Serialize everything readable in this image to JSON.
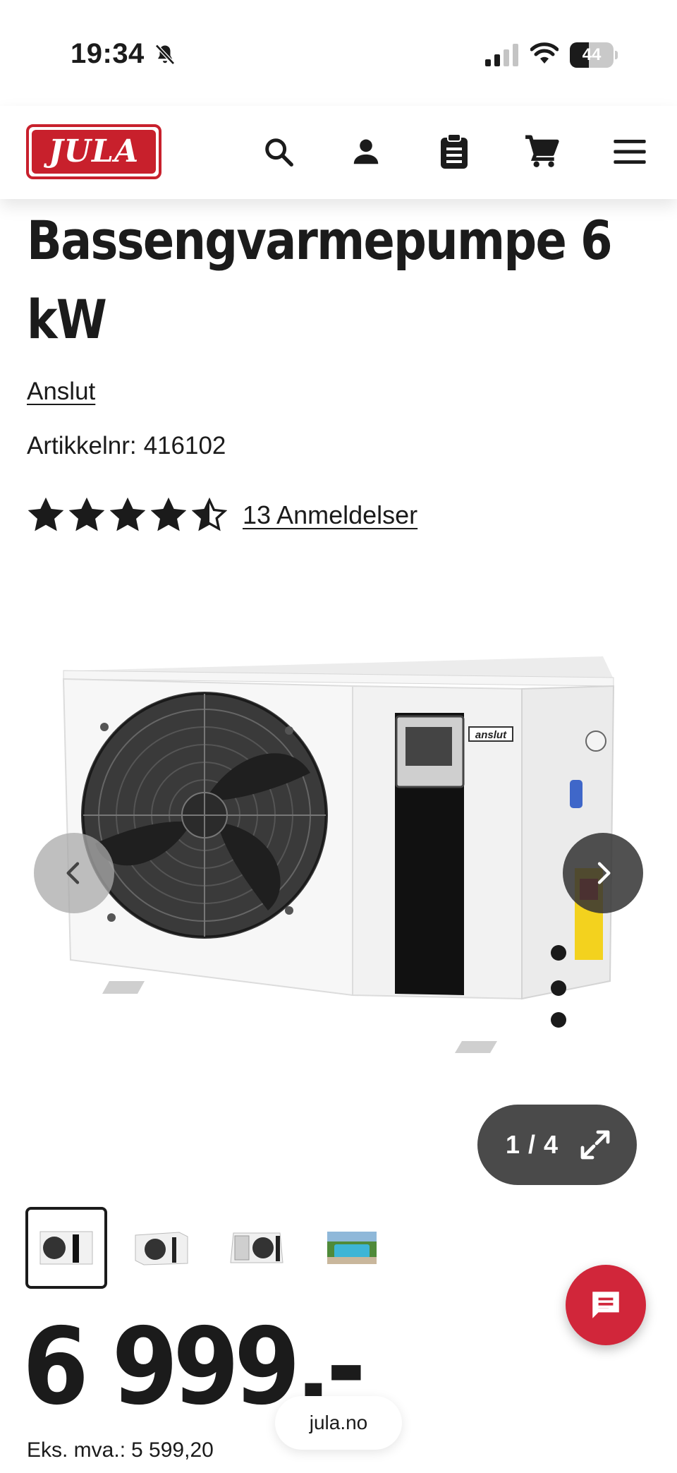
{
  "status_bar": {
    "time": "19:34",
    "battery_level": "44",
    "battery_fraction": 0.44,
    "icons": [
      "bell-slash-icon",
      "signal-icon",
      "wifi-icon",
      "battery-icon"
    ]
  },
  "header": {
    "logo_text": "JULA",
    "icons": [
      "search-icon",
      "account-icon",
      "clipboard-icon",
      "cart-icon",
      "menu-icon"
    ],
    "brand_color": "#c8202c"
  },
  "product": {
    "title": "Bassengvarmepumpe 6 kW",
    "brand": "Anslut",
    "article_label": "Artikkelnr:",
    "article_number": "416102",
    "rating": 4.5,
    "rating_max": 5,
    "reviews_label": "13 Anmeldelser",
    "image_counter": "1 / 4",
    "image_label": "anslut",
    "thumbnails": [
      "heat-pump-front",
      "heat-pump-angle",
      "heat-pump-back",
      "pool-photo"
    ],
    "active_thumbnail": 0,
    "price": "6 999,-",
    "ex_vat_label": "Eks. mva.:",
    "ex_vat_value": "5 599,20"
  },
  "browser": {
    "url": "jula.no"
  },
  "colors": {
    "chat_button": "#d1263a",
    "text": "#1b1b1b"
  }
}
